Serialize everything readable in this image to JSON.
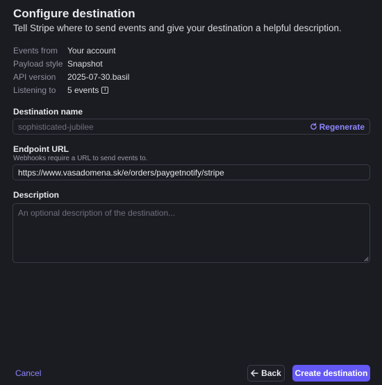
{
  "header": {
    "title": "Configure destination",
    "subtitle": "Tell Stripe where to send events and give your destination a helpful description."
  },
  "meta": {
    "events_from_key": "Events from",
    "events_from_val": "Your account",
    "payload_style_key": "Payload style",
    "payload_style_val": "Snapshot",
    "api_version_key": "API version",
    "api_version_val": "2025-07-30.basil",
    "listening_to_key": "Listening to",
    "listening_to_val": "5 events"
  },
  "destination_name": {
    "label": "Destination name",
    "placeholder": "sophisticated-jubilee",
    "regenerate_label": "Regenerate"
  },
  "endpoint": {
    "label": "Endpoint URL",
    "hint": "Webhooks require a URL to send events to.",
    "value": "https://www.vasadomena.sk/e/orders/paygetnotify/stripe"
  },
  "description": {
    "label": "Description",
    "placeholder": "An optional description of the destination..."
  },
  "footer": {
    "cancel_label": "Cancel",
    "back_label": "Back",
    "create_label": "Create destination"
  },
  "colors": {
    "background": "#1b1c22",
    "accent": "#6459f5",
    "link": "#8e86ff",
    "border": "#3a3c46"
  }
}
